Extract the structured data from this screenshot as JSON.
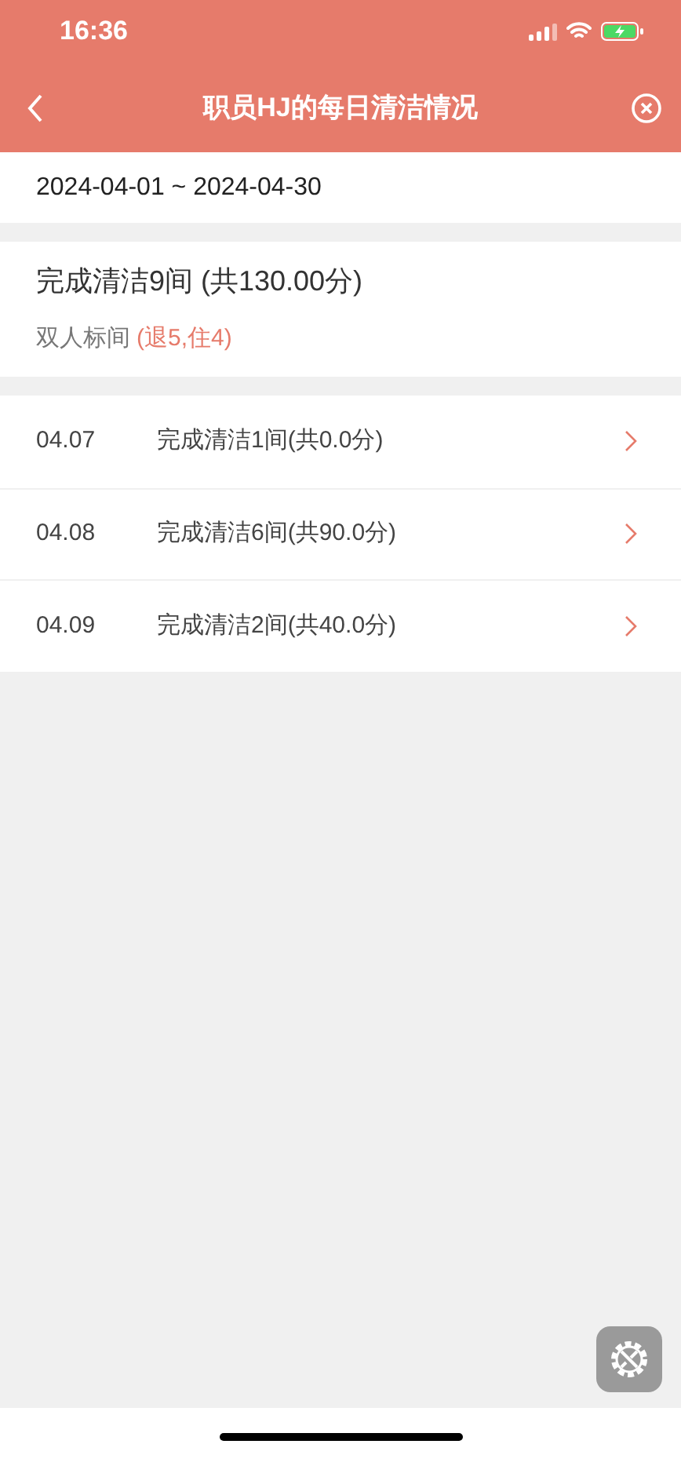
{
  "status_bar": {
    "time": "16:36"
  },
  "header": {
    "title": "职员HJ的每日清洁情况"
  },
  "date_range": "2024-04-01 ~ 2024-04-30",
  "summary": {
    "title": "完成清洁9间 (共130.00分)",
    "room_type": "双人标间",
    "breakdown": "(退5,住4)"
  },
  "days": [
    {
      "date": "04.07",
      "text": "完成清洁1间(共0.0分)"
    },
    {
      "date": "04.08",
      "text": "完成清洁6间(共90.0分)"
    },
    {
      "date": "04.09",
      "text": "完成清洁2间(共40.0分)"
    }
  ]
}
